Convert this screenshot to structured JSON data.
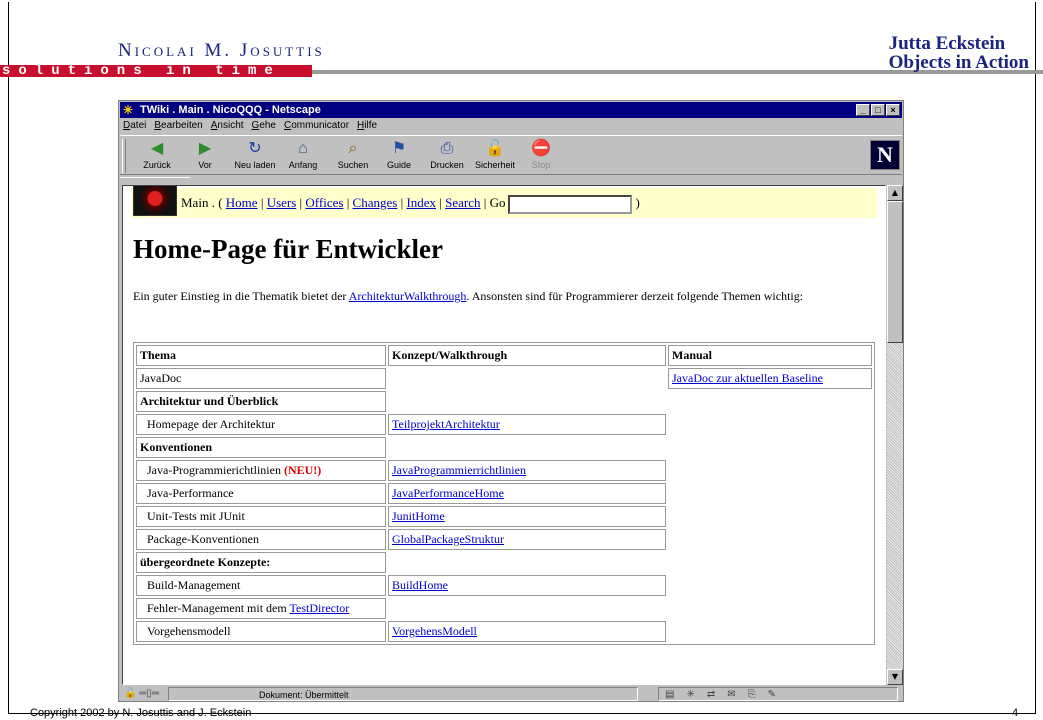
{
  "slide": {
    "logo_name": "Nicolai M. Josuttis",
    "logo_tagline": "solutions in time",
    "author_name": "Jutta Eckstein",
    "author_company": "Objects in Action",
    "copyright": "Copyright 2002 by N. Josuttis and J. Eckstein",
    "page_number": "4"
  },
  "window": {
    "title": "TWiki . Main . NicoQQQ - Netscape",
    "menu": [
      "Datei",
      "Bearbeiten",
      "Ansicht",
      "Gehe",
      "Communicator",
      "Hilfe"
    ],
    "toolbar": [
      {
        "label": "Zurück",
        "icon": "back-arrow-icon"
      },
      {
        "label": "Vor",
        "icon": "forward-arrow-icon"
      },
      {
        "label": "Neu laden",
        "icon": "reload-icon"
      },
      {
        "label": "Anfang",
        "icon": "home-icon"
      },
      {
        "label": "Suchen",
        "icon": "search-icon"
      },
      {
        "label": "Guide",
        "icon": "guide-icon"
      },
      {
        "label": "Drucken",
        "icon": "print-icon"
      },
      {
        "label": "Sicherheit",
        "icon": "security-lock-icon"
      },
      {
        "label": "Stop",
        "icon": "stop-icon"
      }
    ],
    "status_text": "Dokument: Übermittelt"
  },
  "twiki": {
    "web": "Main .",
    "links": [
      "Home",
      "Users",
      "Offices",
      "Changes",
      "Index",
      "Search"
    ],
    "go_label": "Go",
    "go_value": ""
  },
  "content": {
    "title": "Home-Page für Entwickler",
    "intro_before": "Ein guter Einstieg in die Thematik bietet der ",
    "intro_link": "ArchitekturWalkthrough",
    "intro_after": ". Ansonsten sind für Programmierer derzeit folgende Themen wichtig:",
    "headers": [
      "Thema",
      "Konzept/Walkthrough",
      "Manual"
    ],
    "rows": {
      "javadoc": {
        "topic": "JavaDoc",
        "manual": "JavaDoc zur aktuellen Baseline"
      },
      "sec_arch": "Architektur und Überblick",
      "arch_home": {
        "topic": "Homepage der Architektur",
        "concept": "TeilprojektArchitektur"
      },
      "sec_conv": "Konventionen",
      "java_rules": {
        "topic": "Java-Programmierichtlinien",
        "badge": "(NEU!)",
        "concept": "JavaProgrammierrichtlinien"
      },
      "java_perf": {
        "topic": "Java-Performance",
        "concept": "JavaPerformanceHome"
      },
      "unit_tests": {
        "topic": "Unit-Tests mit JUnit",
        "concept": "JunitHome"
      },
      "packages": {
        "topic": "Package-Konventionen",
        "concept": "GlobalPackageStruktur"
      },
      "sec_concepts": "übergeordnete Konzepte:",
      "build": {
        "topic": "Build-Management",
        "concept": "BuildHome"
      },
      "errors": {
        "topic": "Fehler-Management mit dem ",
        "topic_link": "TestDirector"
      },
      "process": {
        "topic": "Vorgehensmodell",
        "concept": "VorgehensModell"
      }
    }
  }
}
